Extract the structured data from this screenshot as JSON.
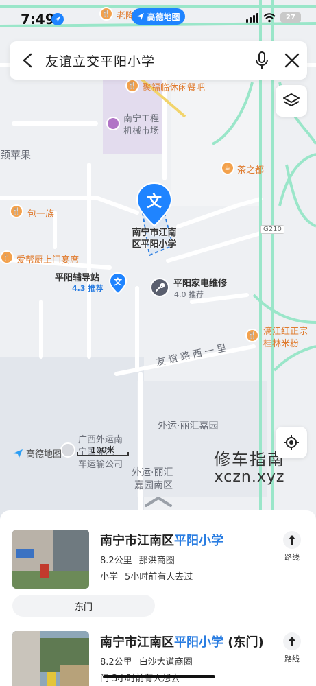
{
  "status_bar": {
    "time": "7:49",
    "app_pill": "高德地图",
    "battery": "27"
  },
  "search": {
    "query": "友谊立交平阳小学"
  },
  "map": {
    "labels": {
      "top_restaurant": "老降",
      "restaurant_1": "聚福临休闲餐吧",
      "machinery_market_1": "南宁工程",
      "machinery_market_2": "机械市场",
      "apple_fragment": "颈苹果",
      "tea": "茶之都",
      "baoyizu": "包一族",
      "road_g210": "G210",
      "aibang": "爱帮厨上门宴席",
      "school_line1": "南宁市江南",
      "school_line2": "区平阳小学",
      "station_name": "平阳辅导站",
      "station_rating": "4.3 推荐",
      "repair_name": "平阳家电维修",
      "repair_rating": "4.0 推荐",
      "noodle_line1": "漓江红正宗",
      "noodle_line2": "桂林米粉",
      "road_youyi": "友谊路西一里",
      "garden": "外运·丽汇嘉园",
      "transport_1": "广西外运南",
      "transport_2": "宁国际汽",
      "transport_3": "车运输公司",
      "garden_south_1": "外运·丽汇",
      "garden_south_2": "嘉园南区",
      "pin_glyph": "文"
    },
    "logo_text": "高德地图",
    "scale": "100米"
  },
  "watermark": {
    "cn": "修车指南",
    "en": "xczn.xyz"
  },
  "results": [
    {
      "title_prefix": "南宁市江南区",
      "title_highlight": "平阳小学",
      "title_suffix": "",
      "distance": "8.2公里",
      "area": "那洪商圈",
      "category": "小学",
      "visited": "5小时前有人去过",
      "route_label": "路线",
      "tag": "东门"
    },
    {
      "title_prefix": "南宁市江南区",
      "title_highlight": "平阳小学",
      "title_suffix": " (东门)",
      "distance": "8.2公里",
      "area": "白沙大道商圈",
      "visited": "门 3小时前有人想去",
      "route_label": "路线"
    }
  ],
  "colors": {
    "accent_blue": "#2a7de1",
    "road_green": "#8fe3c4",
    "poi_orange": "#e07b2e"
  }
}
